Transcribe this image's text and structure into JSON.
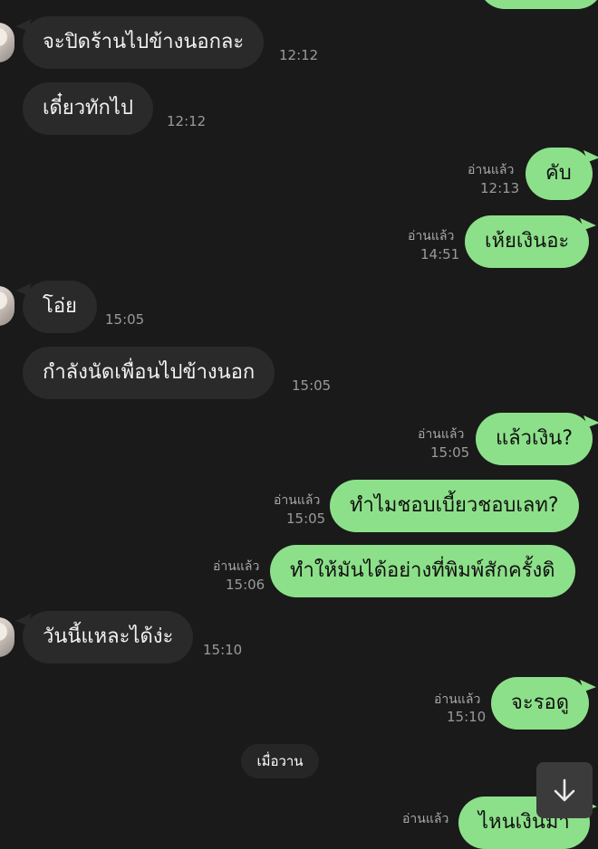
{
  "messages": [
    {
      "text": "จะปิดร้านไปข้างนอกละ",
      "time": "12:12"
    },
    {
      "text": "เดี๋ยวทักไป",
      "time": "12:12"
    },
    {
      "text": "คับ",
      "read": "อ่านแล้ว",
      "time": "12:13"
    },
    {
      "text": "เห้ยเงินอะ",
      "read": "อ่านแล้ว",
      "time": "14:51"
    },
    {
      "text": "โอ่ย",
      "time": "15:05"
    },
    {
      "text": "กำลังนัดเพื่อนไปข้างนอก",
      "time": "15:05"
    },
    {
      "text": "แล้วเงิน?",
      "read": "อ่านแล้ว",
      "time": "15:05"
    },
    {
      "text": "ทำไมชอบเบี้ยวชอบเลท?",
      "read": "อ่านแล้ว",
      "time": "15:05"
    },
    {
      "text": "ทำให้มันได้อย่างที่พิมพ์สักครั้งดิ",
      "read": "อ่านแล้ว",
      "time": "15:06"
    },
    {
      "text": "วันนี้แหละได้ง่ะ",
      "time": "15:10"
    },
    {
      "text": "จะรอดู",
      "read": "อ่านแล้ว",
      "time": "15:10"
    },
    {
      "text": "ไหนเงินมา",
      "read": "อ่านแล้ว"
    }
  ],
  "date_separator": "เมื่อวาน",
  "icons": {
    "scroll_down": "arrow-down-icon",
    "avatar": "avatar-image"
  },
  "colors": {
    "background": "#1a1a1a",
    "incoming_bubble": "#2a2a2a",
    "outgoing_bubble": "#8de08a"
  }
}
